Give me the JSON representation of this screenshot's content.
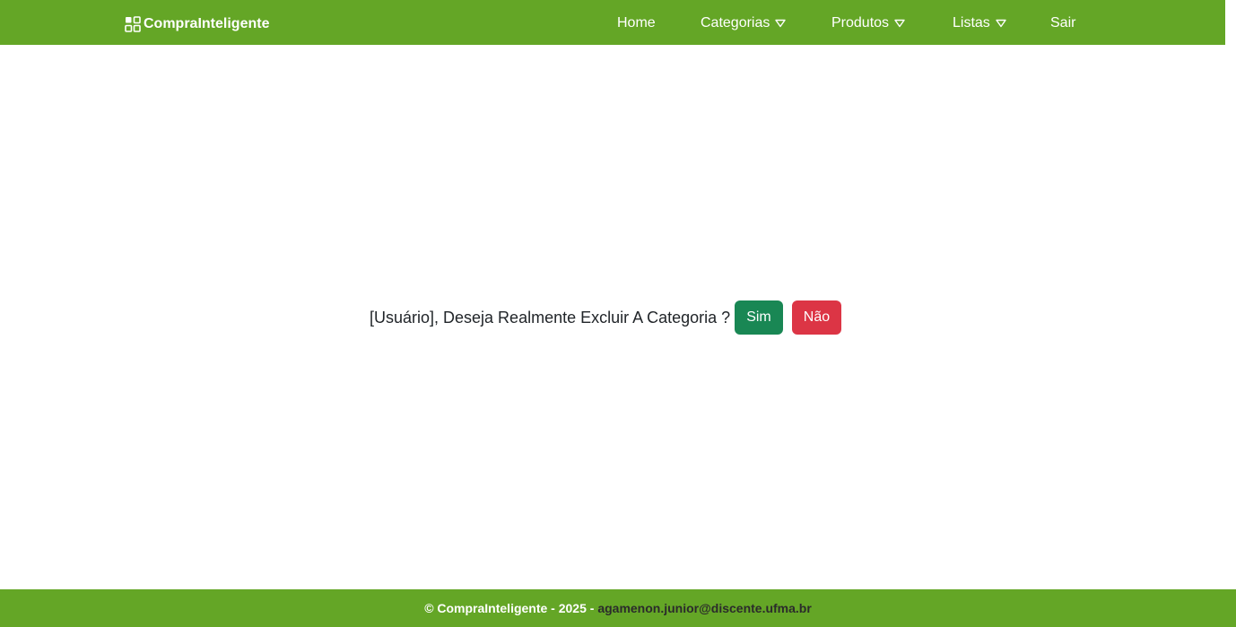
{
  "navbar": {
    "brand": "CompraInteligente",
    "brand_icon": "grid-icon",
    "items": [
      {
        "label": "Home",
        "dropdown": false
      },
      {
        "label": "Categorias",
        "dropdown": true
      },
      {
        "label": "Produtos",
        "dropdown": true
      },
      {
        "label": "Listas",
        "dropdown": true
      },
      {
        "label": "Sair",
        "dropdown": false
      }
    ]
  },
  "dialog": {
    "message": "[Usuário], Deseja Realmente Excluir A Categoria ?",
    "yes_label": "Sim",
    "no_label": "Não"
  },
  "footer": {
    "copyright": "© CompraInteligente - 2025 - ",
    "email": "agamenon.junior@discente.ufma.br"
  },
  "colors": {
    "brand_green": "#64a626",
    "yes_button": "#198754",
    "no_button": "#dc3545"
  }
}
